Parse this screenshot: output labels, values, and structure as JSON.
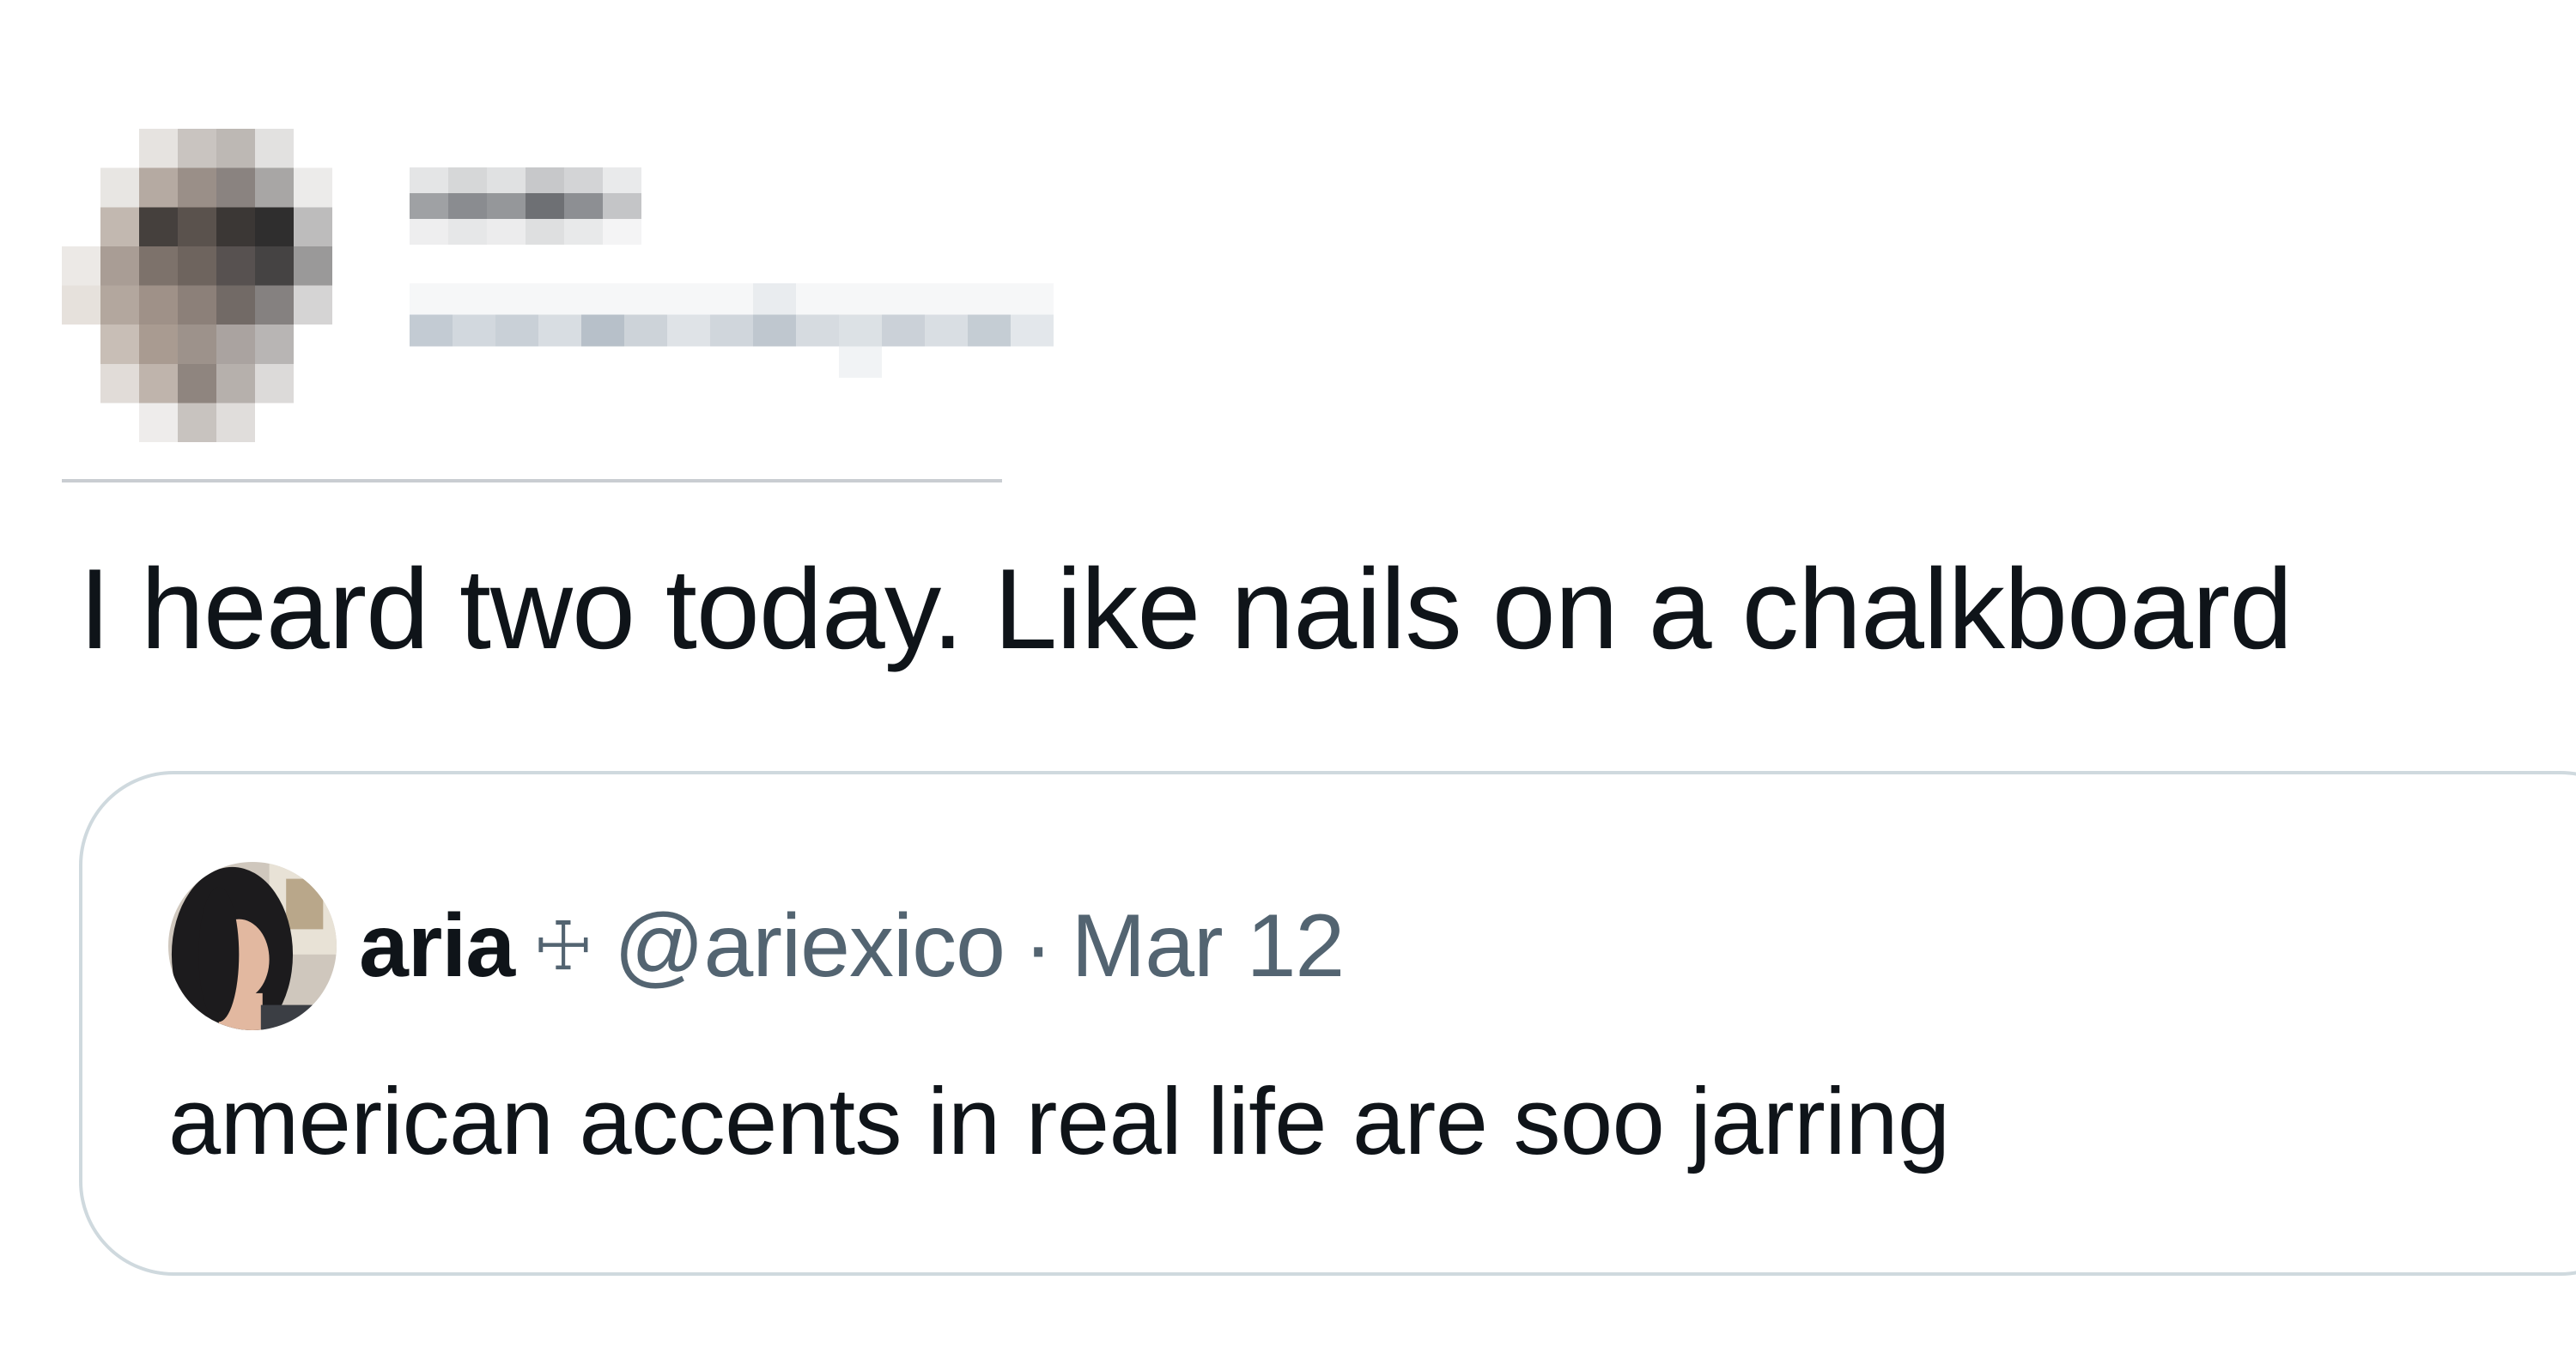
{
  "tweet": {
    "author": {
      "avatar_icon": "pixelated-avatar",
      "name_redacted": true,
      "handle_redacted": true
    },
    "text": "I heard two today. Like nails on a chalkboard"
  },
  "quoted_tweet": {
    "avatar_icon": "user-avatar",
    "name": "aria",
    "badge": "☩",
    "handle": "@ariexico",
    "separator": "·",
    "date": "Mar 12",
    "text": "american accents in real life are soo jarring"
  },
  "colors": {
    "text_primary": "#0f1419",
    "text_secondary": "#536471",
    "border": "#cfd9de",
    "divider": "#c9cdd2"
  }
}
